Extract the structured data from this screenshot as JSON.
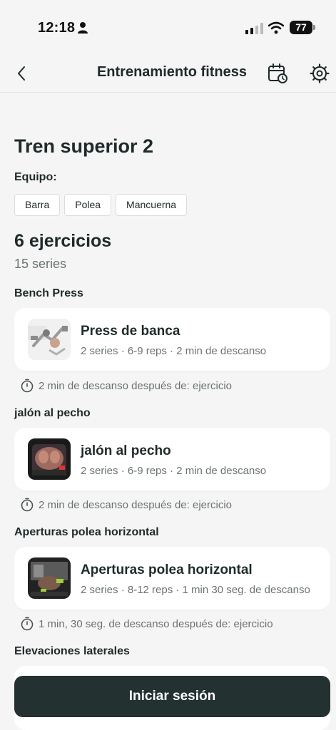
{
  "status_bar": {
    "time": "12:18",
    "battery": "77"
  },
  "nav": {
    "title": "Entrenamiento fitness"
  },
  "routine": {
    "title": "Tren superior 2",
    "equipment_label": "Equipo:",
    "equipment": [
      "Barra",
      "Polea",
      "Mancuerna"
    ],
    "exercise_count": "6 ejercicios",
    "series_count": "15 series"
  },
  "exercises": [
    {
      "group": "Bench Press",
      "name": "Press de banca",
      "detail": "2 series · 6-9 reps · 2 min de descanso",
      "rest": "2 min de descanso después de: ejercicio"
    },
    {
      "group": "jalón al pecho",
      "name": "jalón al pecho",
      "detail": "2 series · 6-9 reps · 2 min de descanso",
      "rest": "2 min de descanso después de: ejercicio"
    },
    {
      "group": "Aperturas polea horizontal",
      "name": "Aperturas polea horizontal",
      "detail": "2 series · 8-12 reps · 1 min 30 seg. de descanso",
      "rest": "1 min, 30 seg. de descanso después de: ejercicio"
    },
    {
      "group": "Elevaciones laterales"
    }
  ],
  "cta": {
    "label": "Iniciar sesión"
  },
  "colors": {
    "background": "#f5f5f5",
    "primary_dark": "#233131",
    "text": "#1f2a2a",
    "muted": "#6b7272"
  }
}
